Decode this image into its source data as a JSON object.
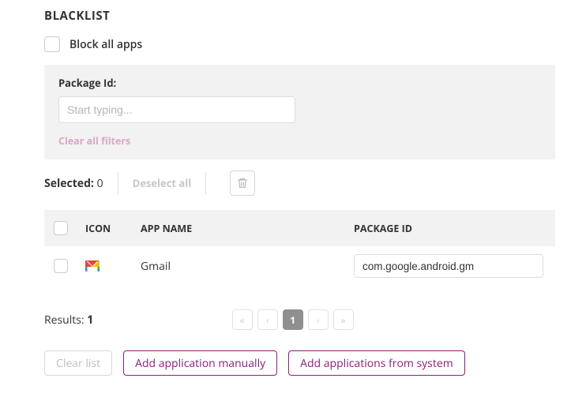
{
  "title": "BLACKLIST",
  "blockAll": {
    "label": "Block all apps"
  },
  "filter": {
    "label": "Package Id:",
    "placeholder": "Start typing...",
    "value": "",
    "clear": "Clear all filters"
  },
  "selection": {
    "label": "Selected:",
    "count": "0",
    "deselect": "Deselect all"
  },
  "columns": {
    "icon": "ICON",
    "name": "APP NAME",
    "pkg": "PACKAGE ID"
  },
  "rows": [
    {
      "name": "Gmail",
      "packageId": "com.google.android.gm"
    }
  ],
  "results": {
    "label": "Results:",
    "count": "1"
  },
  "pager": {
    "current": "1"
  },
  "actions": {
    "clear": "Clear list",
    "addManual": "Add application manually",
    "addSystem": "Add applications from system"
  }
}
